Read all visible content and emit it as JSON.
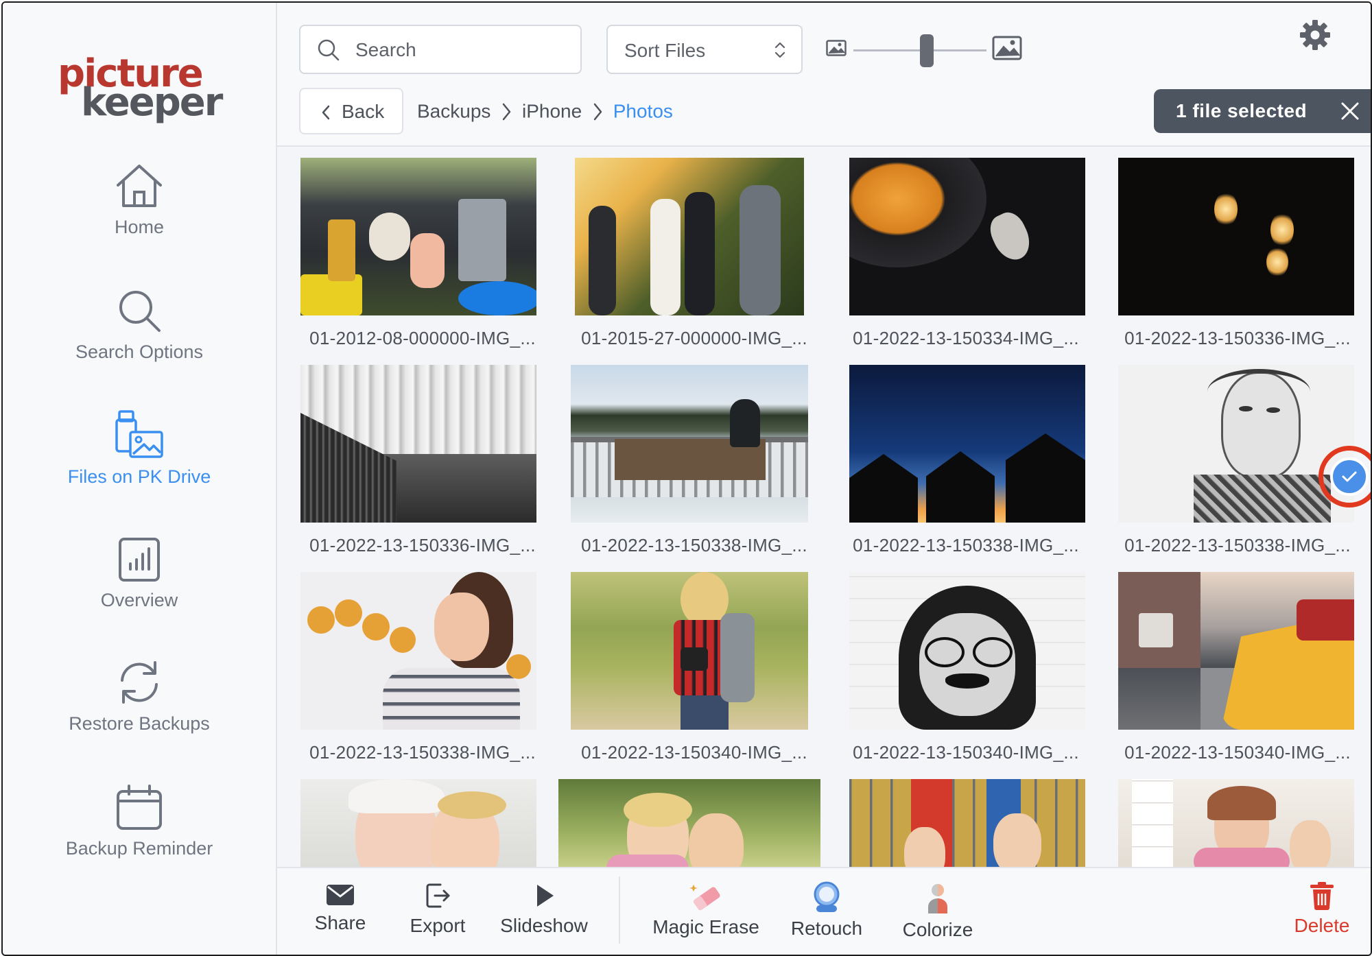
{
  "logo": {
    "line1": "picture",
    "line2": "keeper"
  },
  "sidebar": {
    "items": [
      {
        "label": "Home",
        "icon": "home-icon",
        "active": false
      },
      {
        "label": "Search Options",
        "icon": "search-icon",
        "active": false
      },
      {
        "label": "Files on PK Drive",
        "icon": "drive-photos-icon",
        "active": true
      },
      {
        "label": "Overview",
        "icon": "chart-icon",
        "active": false
      },
      {
        "label": "Restore Backups",
        "icon": "sync-icon",
        "active": false
      },
      {
        "label": "Backup Reminder",
        "icon": "calendar-icon",
        "active": false
      }
    ]
  },
  "toolbar": {
    "search_placeholder": "Search",
    "sort_label": "Sort Files",
    "zoom_level": 0.55
  },
  "breadcrumb": {
    "back_label": "Back",
    "items": [
      "Backups",
      "iPhone",
      "Photos"
    ]
  },
  "selection": {
    "label": "1 file selected"
  },
  "files": [
    {
      "name": "01-2012-08-000000-IMG_...",
      "selected": false
    },
    {
      "name": "01-2015-27-000000-IMG_...",
      "selected": false
    },
    {
      "name": "01-2022-13-150334-IMG_...",
      "selected": false
    },
    {
      "name": "01-2022-13-150336-IMG_...",
      "selected": false
    },
    {
      "name": "01-2022-13-150336-IMG_...",
      "selected": false
    },
    {
      "name": "01-2022-13-150338-IMG_...",
      "selected": false
    },
    {
      "name": "01-2022-13-150338-IMG_...",
      "selected": false
    },
    {
      "name": "01-2022-13-150338-IMG_...",
      "selected": true
    },
    {
      "name": "01-2022-13-150338-IMG_...",
      "selected": false
    },
    {
      "name": "01-2022-13-150340-IMG_...",
      "selected": false
    },
    {
      "name": "01-2022-13-150340-IMG_...",
      "selected": false
    },
    {
      "name": "01-2022-13-150340-IMG_...",
      "selected": false
    },
    {
      "name": "",
      "selected": false
    },
    {
      "name": "",
      "selected": false
    },
    {
      "name": "",
      "selected": false
    },
    {
      "name": "",
      "selected": false
    }
  ],
  "actions": [
    {
      "label": "Share",
      "icon": "envelope-icon"
    },
    {
      "label": "Export",
      "icon": "export-icon"
    },
    {
      "label": "Slideshow",
      "icon": "play-icon"
    },
    {
      "label": "Magic Erase",
      "icon": "eraser-icon"
    },
    {
      "label": "Retouch",
      "icon": "retouch-icon"
    },
    {
      "label": "Colorize",
      "icon": "colorize-icon"
    },
    {
      "label": "Delete",
      "icon": "trash-icon"
    }
  ],
  "colors": {
    "accent": "#3a8ff0",
    "brand_red": "#b8372f",
    "danger": "#d93a2b",
    "pill": "#4d5561"
  }
}
